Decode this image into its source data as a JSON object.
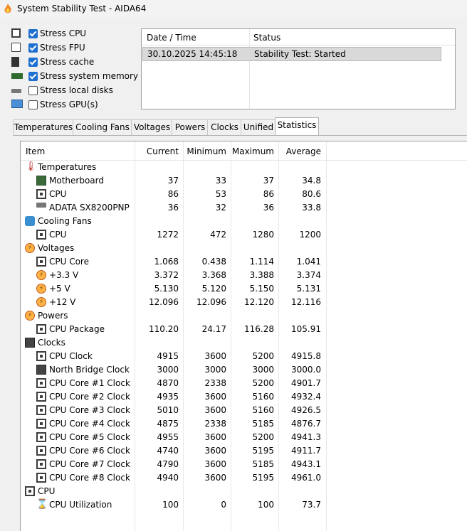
{
  "window": {
    "title": "System Stability Test - AIDA64"
  },
  "stress": [
    {
      "label": "Stress CPU",
      "checked": true,
      "icon": "cpu-chip-icon"
    },
    {
      "label": "Stress FPU",
      "checked": true,
      "icon": "fpu-percent-icon"
    },
    {
      "label": "Stress cache",
      "checked": true,
      "icon": "cache-chip-icon"
    },
    {
      "label": "Stress system memory",
      "checked": true,
      "icon": "memory-module-icon"
    },
    {
      "label": "Stress local disks",
      "checked": false,
      "icon": "disk-drive-icon"
    },
    {
      "label": "Stress GPU(s)",
      "checked": false,
      "icon": "gpu-monitor-icon"
    }
  ],
  "log": {
    "col_datetime": "Date / Time",
    "col_status": "Status",
    "rows": [
      {
        "datetime": "30.10.2025 14:45:18",
        "status": "Stability Test: Started"
      }
    ]
  },
  "tabs": [
    "Temperatures",
    "Cooling Fans",
    "Voltages",
    "Powers",
    "Clocks",
    "Unified",
    "Statistics"
  ],
  "active_tab": "Statistics",
  "table": {
    "headers": {
      "item": "Item",
      "current": "Current",
      "minimum": "Minimum",
      "maximum": "Maximum",
      "average": "Average"
    },
    "rows": [
      {
        "type": "group",
        "label": "Temperatures",
        "icon": "thermometer-icon"
      },
      {
        "type": "item",
        "label": "Motherboard",
        "icon": "motherboard-icon",
        "current": "37",
        "minimum": "33",
        "maximum": "37",
        "average": "34.8"
      },
      {
        "type": "item",
        "label": "CPU",
        "icon": "cpu-chip-icon",
        "current": "86",
        "minimum": "53",
        "maximum": "86",
        "average": "80.6"
      },
      {
        "type": "item",
        "label": "ADATA SX8200PNP",
        "icon": "disk-drive-icon",
        "current": "36",
        "minimum": "32",
        "maximum": "36",
        "average": "33.8"
      },
      {
        "type": "group",
        "label": "Cooling Fans",
        "icon": "fan-icon"
      },
      {
        "type": "item",
        "label": "CPU",
        "icon": "cpu-chip-icon",
        "current": "1272",
        "minimum": "472",
        "maximum": "1280",
        "average": "1200"
      },
      {
        "type": "group",
        "label": "Voltages",
        "icon": "voltage-bolt-icon"
      },
      {
        "type": "item",
        "label": "CPU Core",
        "icon": "cpu-chip-icon",
        "current": "1.068",
        "minimum": "0.438",
        "maximum": "1.114",
        "average": "1.041"
      },
      {
        "type": "item",
        "label": "+3.3 V",
        "icon": "voltage-bolt-icon",
        "current": "3.372",
        "minimum": "3.368",
        "maximum": "3.388",
        "average": "3.374"
      },
      {
        "type": "item",
        "label": "+5 V",
        "icon": "voltage-bolt-icon",
        "current": "5.130",
        "minimum": "5.120",
        "maximum": "5.150",
        "average": "5.131"
      },
      {
        "type": "item",
        "label": "+12 V",
        "icon": "voltage-bolt-icon",
        "current": "12.096",
        "minimum": "12.096",
        "maximum": "12.120",
        "average": "12.116"
      },
      {
        "type": "group",
        "label": "Powers",
        "icon": "power-bolt-icon"
      },
      {
        "type": "item",
        "label": "CPU Package",
        "icon": "cpu-chip-icon",
        "current": "110.20",
        "minimum": "24.17",
        "maximum": "116.28",
        "average": "105.91"
      },
      {
        "type": "group",
        "label": "Clocks",
        "icon": "clock-chip-icon"
      },
      {
        "type": "item",
        "label": "CPU Clock",
        "icon": "cpu-chip-icon",
        "current": "4915",
        "minimum": "3600",
        "maximum": "5200",
        "average": "4915.8"
      },
      {
        "type": "item",
        "label": "North Bridge Clock",
        "icon": "northbridge-chip-icon",
        "current": "3000",
        "minimum": "3000",
        "maximum": "3000",
        "average": "3000.0"
      },
      {
        "type": "item",
        "label": "CPU Core #1 Clock",
        "icon": "cpu-chip-icon",
        "current": "4870",
        "minimum": "2338",
        "maximum": "5200",
        "average": "4901.7"
      },
      {
        "type": "item",
        "label": "CPU Core #2 Clock",
        "icon": "cpu-chip-icon",
        "current": "4935",
        "minimum": "3600",
        "maximum": "5160",
        "average": "4932.4"
      },
      {
        "type": "item",
        "label": "CPU Core #3 Clock",
        "icon": "cpu-chip-icon",
        "current": "5010",
        "minimum": "3600",
        "maximum": "5160",
        "average": "4926.5"
      },
      {
        "type": "item",
        "label": "CPU Core #4 Clock",
        "icon": "cpu-chip-icon",
        "current": "4875",
        "minimum": "2338",
        "maximum": "5185",
        "average": "4876.7"
      },
      {
        "type": "item",
        "label": "CPU Core #5 Clock",
        "icon": "cpu-chip-icon",
        "current": "4955",
        "minimum": "3600",
        "maximum": "5200",
        "average": "4941.3"
      },
      {
        "type": "item",
        "label": "CPU Core #6 Clock",
        "icon": "cpu-chip-icon",
        "current": "4740",
        "minimum": "3600",
        "maximum": "5195",
        "average": "4911.7"
      },
      {
        "type": "item",
        "label": "CPU Core #7 Clock",
        "icon": "cpu-chip-icon",
        "current": "4790",
        "minimum": "3600",
        "maximum": "5185",
        "average": "4943.1"
      },
      {
        "type": "item",
        "label": "CPU Core #8 Clock",
        "icon": "cpu-chip-icon",
        "current": "4940",
        "minimum": "3600",
        "maximum": "5195",
        "average": "4961.0"
      },
      {
        "type": "group",
        "label": "CPU",
        "icon": "cpu-chip-icon"
      },
      {
        "type": "item",
        "label": "CPU Utilization",
        "icon": "hourglass-icon",
        "current": "100",
        "minimum": "0",
        "maximum": "100",
        "average": "73.7"
      }
    ]
  }
}
